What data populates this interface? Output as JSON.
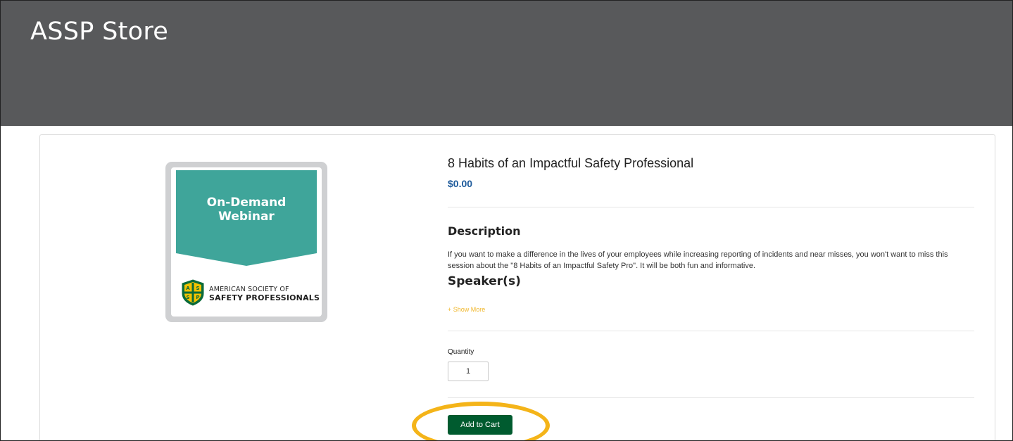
{
  "header": {
    "site_title": "ASSP Store",
    "background_color": "#58595b"
  },
  "product": {
    "image": {
      "banner_line1": "On-Demand",
      "banner_line2": "Webinar",
      "banner_color": "#3fa59a",
      "org_name_line1": "AMERICAN SOCIETY OF",
      "org_name_line2": "SAFETY PROFESSIONALS",
      "logo_letters": [
        "A",
        "S",
        "S",
        "P"
      ]
    },
    "title": "8 Habits of an Impactful Safety Professional",
    "price": "$0.00",
    "price_color": "#1d5a9b",
    "description_heading": "Description",
    "description_text": "If you want to make a difference in the lives of your employees while increasing reporting of incidents and near misses, you won't want to miss this session about the \"8 Habits of an Impactful Safety Pro\". It will be both fun and informative.",
    "speakers_heading": "Speaker(s)",
    "show_more_label": "+ Show More",
    "quantity_label": "Quantity",
    "quantity_value": "1",
    "add_to_cart_label": "Add to Cart",
    "add_to_cart_color": "#005b2f"
  },
  "annotation": {
    "highlight_color": "#f4b419"
  }
}
